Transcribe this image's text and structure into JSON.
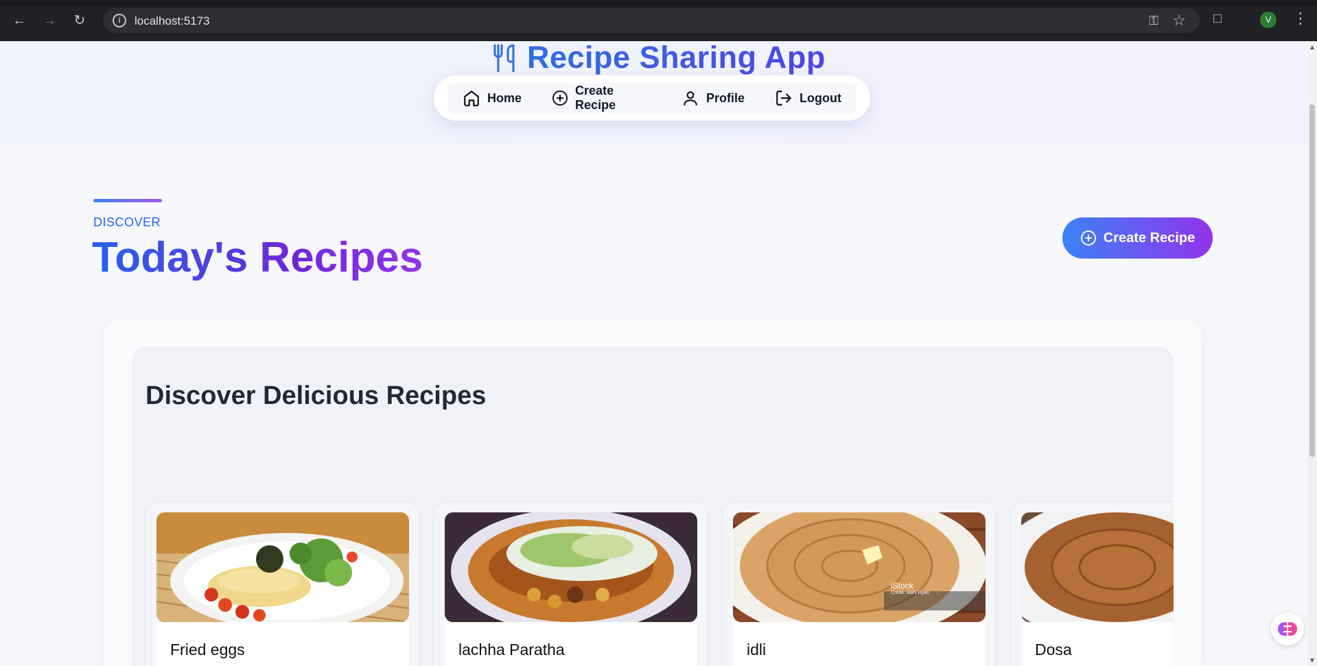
{
  "browser": {
    "url": "localhost:5173",
    "profile_initial": "V",
    "icons": [
      "back-icon",
      "forward-icon",
      "reload-icon",
      "site-info-icon",
      "password-key-icon",
      "bookmark-star-icon",
      "extensions-icon",
      "menu-dots-icon"
    ]
  },
  "header": {
    "app_title": "Recipe Sharing App",
    "nav": [
      {
        "label": "Home",
        "icon": "home-icon"
      },
      {
        "label": "Create Recipe",
        "icon": "plus-circle-icon"
      },
      {
        "label": "Profile",
        "icon": "user-icon"
      },
      {
        "label": "Logout",
        "icon": "logout-icon"
      }
    ]
  },
  "section": {
    "eyebrow": "DISCOVER",
    "title": "Today's Recipes",
    "cta_label": "Create Recipe"
  },
  "recipes_panel": {
    "title": "Discover Delicious Recipes",
    "recipes": [
      {
        "name": "Fried eggs"
      },
      {
        "name": "lachha Paratha"
      },
      {
        "name": "idli",
        "photo_watermark": "iStock",
        "photo_credit": "Credit: Mahi Ryan"
      },
      {
        "name": "Dosa"
      }
    ]
  },
  "colors": {
    "brand_blue": "#2f6fe0",
    "accent_purple": "#9333ea",
    "chrome_dark": "#202124"
  }
}
